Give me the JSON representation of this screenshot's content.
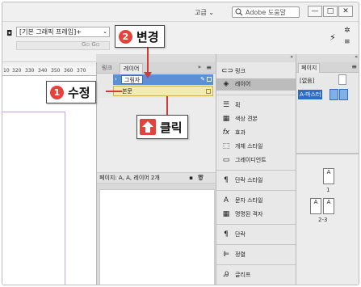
{
  "titlebar": {
    "workspace_label": "고급 ⌄",
    "help_search_placeholder": "Adobe 도움말",
    "minimize": "—",
    "restore": "□",
    "close": "✕"
  },
  "controlbar": {
    "frame_style_value": "[기본 그래픽 프레임]+",
    "frame_style_chevron": "⌄",
    "mini_icons": "G▫ G▫",
    "bolt_icon": "⚡"
  },
  "ruler": {
    "ticks": [
      "10",
      "320",
      "330",
      "340",
      "350",
      "360",
      "370"
    ]
  },
  "layers_panel": {
    "tab_links": "링크",
    "tab_layers": "레이어",
    "collapse": "»",
    "menu": "≡",
    "rows": [
      {
        "label": "그림자"
      },
      {
        "label": "본문"
      }
    ],
    "footer_text": "페이지: A, A, 레이어 2개"
  },
  "icon_panel": {
    "dock_arrows": "»",
    "items": [
      {
        "icon": "link-icon",
        "glyph": "⊂⊃",
        "label": "링크"
      },
      {
        "icon": "layers-icon",
        "glyph": "◈",
        "label": "레이어"
      },
      {
        "icon": "stroke-icon",
        "glyph": "☰",
        "label": "획"
      },
      {
        "icon": "swatches-icon",
        "glyph": "▦",
        "label": "색상 견본"
      },
      {
        "icon": "effects-icon",
        "glyph": "fx",
        "label": "효과"
      },
      {
        "icon": "object-style-icon",
        "glyph": "⬚",
        "label": "개체 스타일"
      },
      {
        "icon": "gradient-icon",
        "glyph": "▭",
        "label": "그레이디언트"
      },
      {
        "icon": "paragraph-style-icon",
        "glyph": "¶",
        "label": "단락 스타일"
      },
      {
        "icon": "character-style-icon",
        "glyph": "A",
        "label": "문자 스타일"
      },
      {
        "icon": "named-grid-icon",
        "glyph": "▦",
        "label": "명명된 격자"
      },
      {
        "icon": "paragraph-icon",
        "glyph": "¶",
        "label": "단락"
      },
      {
        "icon": "align-icon",
        "glyph": "⊫",
        "label": "정렬"
      },
      {
        "icon": "glyphs-icon",
        "glyph": "Ꭿ",
        "label": "글리프"
      }
    ]
  },
  "pages_panel": {
    "dock_arrows": "«",
    "tab": "페이지",
    "menu": "≡",
    "master_none": "[없음]",
    "master_a": "A-마스터",
    "page1_letter": "A",
    "page1_label": "1",
    "spread_letter_left": "A",
    "spread_letter_right": "A",
    "spread_label": "2-3"
  },
  "annotations": {
    "edit_num": "1",
    "edit_text": "수정",
    "change_num": "2",
    "change_text": "변경",
    "click_text": "클릭",
    "accent_color": "#e2433b"
  }
}
